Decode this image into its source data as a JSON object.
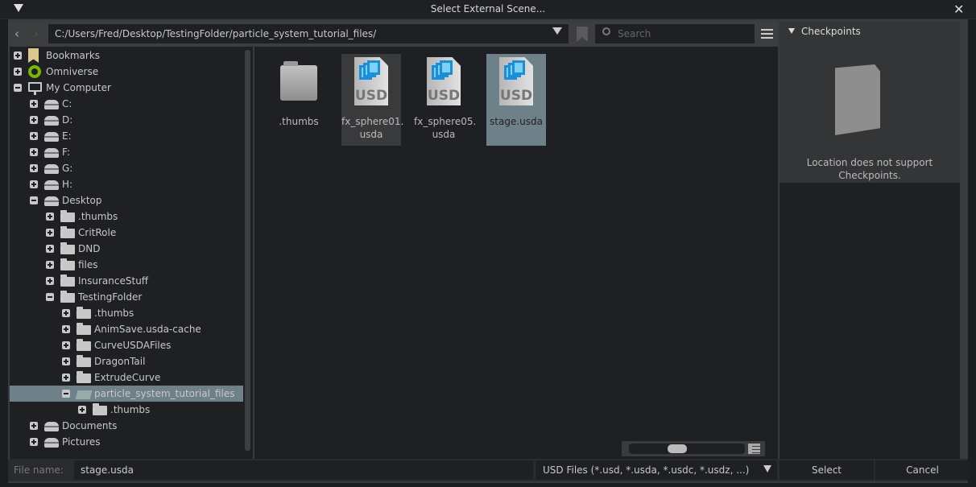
{
  "window": {
    "title": "Select External Scene..."
  },
  "toolbar": {
    "path": "C:/Users/Fred/Desktop/TestingFolder/particle_system_tutorial_files/",
    "search_placeholder": "Search"
  },
  "tree": [
    {
      "label": "Bookmarks",
      "level": 0,
      "state": "plus",
      "icon": "bookmark"
    },
    {
      "label": "Omniverse",
      "level": 0,
      "state": "plus",
      "icon": "omniverse"
    },
    {
      "label": "My Computer",
      "level": 0,
      "state": "minus",
      "icon": "computer"
    },
    {
      "label": "C:",
      "level": 1,
      "state": "plus",
      "icon": "drive"
    },
    {
      "label": "D:",
      "level": 1,
      "state": "plus",
      "icon": "drive"
    },
    {
      "label": "E:",
      "level": 1,
      "state": "plus",
      "icon": "drive"
    },
    {
      "label": "F:",
      "level": 1,
      "state": "plus",
      "icon": "drive"
    },
    {
      "label": "G:",
      "level": 1,
      "state": "plus",
      "icon": "drive"
    },
    {
      "label": "H:",
      "level": 1,
      "state": "plus",
      "icon": "drive"
    },
    {
      "label": "Desktop",
      "level": 1,
      "state": "minus",
      "icon": "drive"
    },
    {
      "label": ".thumbs",
      "level": 2,
      "state": "plus",
      "icon": "folder"
    },
    {
      "label": "CritRole",
      "level": 2,
      "state": "plus",
      "icon": "folder"
    },
    {
      "label": "DND",
      "level": 2,
      "state": "plus",
      "icon": "folder"
    },
    {
      "label": "files",
      "level": 2,
      "state": "plus",
      "icon": "folder"
    },
    {
      "label": "InsuranceStuff",
      "level": 2,
      "state": "plus",
      "icon": "folder"
    },
    {
      "label": "TestingFolder",
      "level": 2,
      "state": "minus",
      "icon": "folder"
    },
    {
      "label": ".thumbs",
      "level": 3,
      "state": "plus",
      "icon": "folder"
    },
    {
      "label": "AnimSave.usda-cache",
      "level": 3,
      "state": "plus",
      "icon": "folder"
    },
    {
      "label": "CurveUSDAFiles",
      "level": 3,
      "state": "plus",
      "icon": "folder"
    },
    {
      "label": "DragonTail",
      "level": 3,
      "state": "plus",
      "icon": "folder"
    },
    {
      "label": "ExtrudeCurve",
      "level": 3,
      "state": "plus",
      "icon": "folder"
    },
    {
      "label": "particle_system_tutorial_files",
      "level": 3,
      "state": "minus",
      "icon": "folder-open",
      "selected": true
    },
    {
      "label": ".thumbs",
      "level": 4,
      "state": "plus",
      "icon": "folder"
    },
    {
      "label": "Documents",
      "level": 1,
      "state": "plus",
      "icon": "drive"
    },
    {
      "label": "Pictures",
      "level": 1,
      "state": "plus",
      "icon": "drive"
    }
  ],
  "files": [
    {
      "name": ".thumbs",
      "type": "folder"
    },
    {
      "name": "fx_sphere01.\nusda",
      "type": "usd",
      "hover": true
    },
    {
      "name": "fx_sphere05.\nusda",
      "type": "usd"
    },
    {
      "name": "stage.usda",
      "type": "usd",
      "selected": true
    }
  ],
  "checkpoints": {
    "title": "Checkpoints",
    "message": "Location does not support Checkpoints."
  },
  "footer": {
    "file_name_label": "File name:",
    "file_name": "stage.usda",
    "filter": "USD Files (*.usd, *.usda, *.usdc, *.usdz, ...)",
    "select": "Select",
    "cancel": "Cancel"
  },
  "colors": {
    "selection": "#6e8088",
    "omniverse": "#76b900",
    "usd_blue": "#1b8fd6"
  }
}
